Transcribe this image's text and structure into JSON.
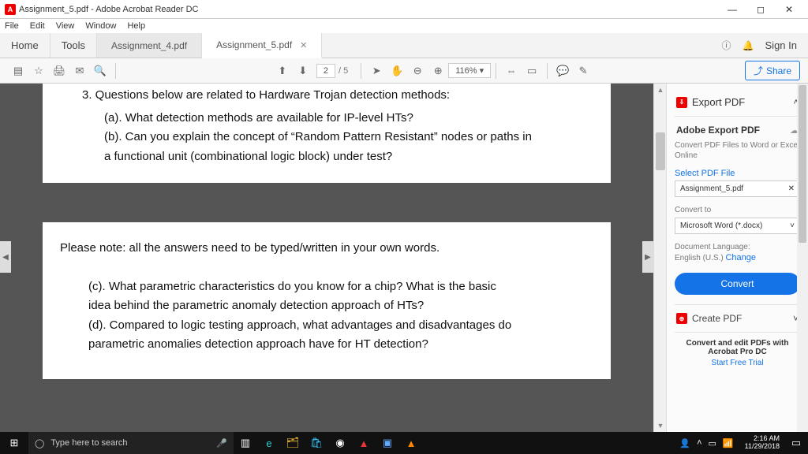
{
  "window": {
    "title": "Assignment_5.pdf - Adobe Acrobat Reader DC"
  },
  "menu": {
    "file": "File",
    "edit": "Edit",
    "view": "View",
    "window": "Window",
    "help": "Help"
  },
  "tabs": {
    "home": "Home",
    "tools": "Tools",
    "t1": "Assignment_4.pdf",
    "t2": "Assignment_5.pdf",
    "signin": "Sign In"
  },
  "toolbar": {
    "page_cur": "2",
    "page_of": "/ 5",
    "zoom": "116%",
    "share": "Share"
  },
  "doc": {
    "q3": "3.  Questions below are related to Hardware Trojan detection methods:",
    "a": "(a). What detection methods are available for IP-level HTs?",
    "b": "(b). Can you explain the concept of “Random Pattern Resistant” nodes or paths in",
    "b2": "a functional unit (combinational logic block) under test?",
    "note": "Please note: all the answers need to be typed/written in your own words.",
    "c": "(c). What parametric characteristics do you know for a chip? What is the basic",
    "c2": "idea behind the parametric anomaly detection approach of HTs?",
    "d": "(d). Compared to logic testing approach, what advantages and disadvantages do",
    "d2": "parametric anomalies detection approach have for HT detection?"
  },
  "side": {
    "export": "Export PDF",
    "adobe": "Adobe Export PDF",
    "desc": "Convert PDF Files to Word or Excel Online",
    "selectlabel": "Select PDF File",
    "file": "Assignment_5.pdf",
    "convertto": "Convert to",
    "format": "Microsoft Word (*.docx)",
    "doclang": "Document Language:",
    "lang": "English (U.S.) ",
    "change": "Change",
    "convert": "Convert",
    "create": "Create PDF",
    "promo": "Convert and edit PDFs with Acrobat Pro DC",
    "trial": "Start Free Trial"
  },
  "taskbar": {
    "search": "Type here to search",
    "time": "2:16 AM",
    "date": "11/29/2018"
  }
}
